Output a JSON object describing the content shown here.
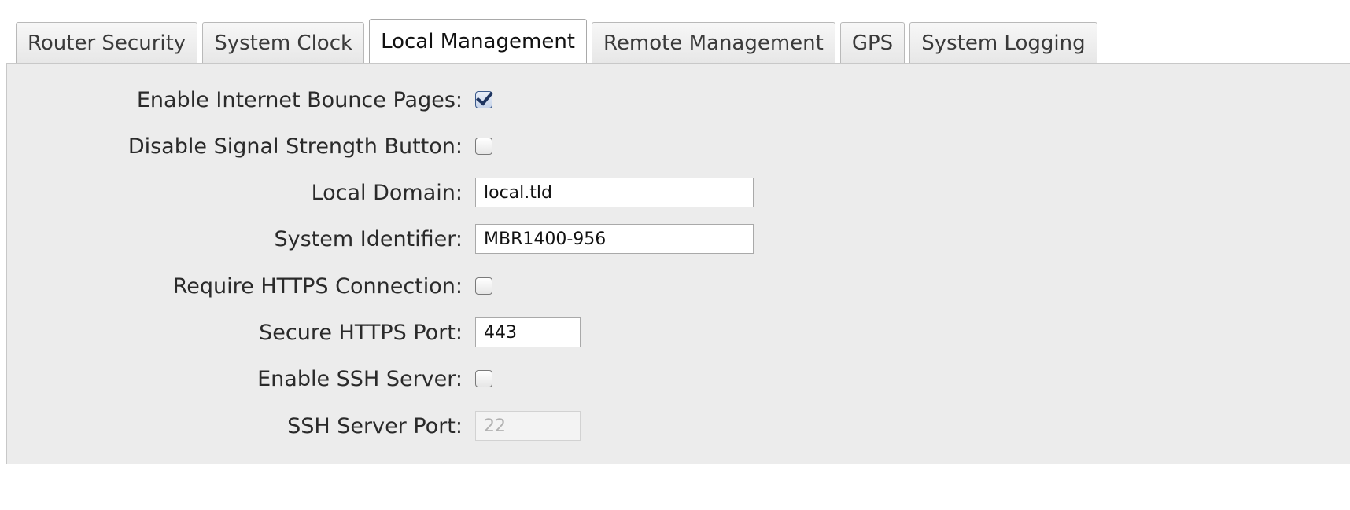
{
  "tabs": [
    {
      "label": "Router Security",
      "active": false
    },
    {
      "label": "System Clock",
      "active": false
    },
    {
      "label": "Local Management",
      "active": true
    },
    {
      "label": "Remote Management",
      "active": false
    },
    {
      "label": "GPS",
      "active": false
    },
    {
      "label": "System Logging",
      "active": false
    }
  ],
  "form": {
    "enable_bounce_pages": {
      "label": "Enable Internet Bounce Pages:",
      "checked": true
    },
    "disable_signal_button": {
      "label": "Disable Signal Strength Button:",
      "checked": false
    },
    "local_domain": {
      "label": "Local Domain:",
      "value": "local.tld"
    },
    "system_identifier": {
      "label": "System Identifier:",
      "value": "MBR1400-956"
    },
    "require_https": {
      "label": "Require HTTPS Connection:",
      "checked": false
    },
    "https_port": {
      "label": "Secure HTTPS Port:",
      "value": "443"
    },
    "enable_ssh": {
      "label": "Enable SSH Server:",
      "checked": false
    },
    "ssh_port": {
      "label": "SSH Server Port:",
      "value": "22",
      "disabled": true
    }
  },
  "colors": {
    "panel_background": "#ececec",
    "checkbox_checked": "#1f3560"
  }
}
